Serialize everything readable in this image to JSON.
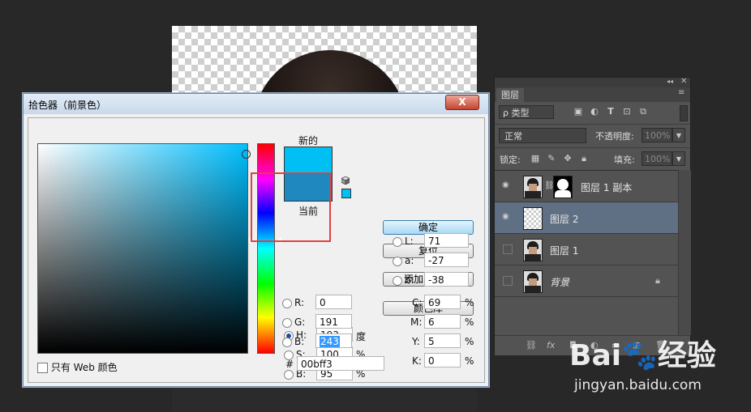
{
  "colors": {
    "accent_new": "#00bff3",
    "accent_current": "#1e88bf",
    "highlight_box": "#e04040"
  },
  "picker": {
    "title": "拾色器（前景色）",
    "close_label": "X",
    "new_label": "新的",
    "current_label": "当前",
    "web_only_label": "只有 Web 颜色",
    "buttons": {
      "ok": "确定",
      "reset": "复位",
      "add_swatch": "添加到色板",
      "color_library": "颜色库"
    },
    "hsb": [
      {
        "label": "H:",
        "value": "193",
        "unit": "度",
        "selected": true
      },
      {
        "label": "S:",
        "value": "100",
        "unit": "%",
        "selected": false
      },
      {
        "label": "B:",
        "value": "95",
        "unit": "%",
        "selected": false
      }
    ],
    "rgb": [
      {
        "label": "R:",
        "value": "0"
      },
      {
        "label": "G:",
        "value": "191"
      },
      {
        "label": "B:",
        "value": "243"
      }
    ],
    "lab": [
      {
        "label": "L:",
        "value": "71"
      },
      {
        "label": "a:",
        "value": "-27"
      },
      {
        "label": "b:",
        "value": "-38"
      }
    ],
    "cmyk": [
      {
        "label": "C:",
        "value": "69",
        "unit": "%"
      },
      {
        "label": "M:",
        "value": "6",
        "unit": "%"
      },
      {
        "label": "Y:",
        "value": "5",
        "unit": "%"
      },
      {
        "label": "K:",
        "value": "0",
        "unit": "%"
      }
    ],
    "hex_label": "#",
    "hex_value": "00bff3"
  },
  "layers_panel": {
    "tab_label": "图层",
    "filter_label": "ρ 类型",
    "blend_mode": "正常",
    "opacity_label": "不透明度:",
    "opacity_value": "100%",
    "lock_label": "锁定:",
    "fill_label": "填充:",
    "fill_value": "100%",
    "layers": [
      {
        "name": "图层 1 副本",
        "visible": true,
        "selected": false
      },
      {
        "name": "图层 2",
        "visible": true,
        "selected": true
      },
      {
        "name": "图层 1",
        "visible": false,
        "selected": false
      },
      {
        "name": "背景",
        "visible": false,
        "selected": false
      }
    ]
  },
  "watermark": {
    "logo": "Bai🐾经验",
    "url": "jingyan.baidu.com"
  }
}
